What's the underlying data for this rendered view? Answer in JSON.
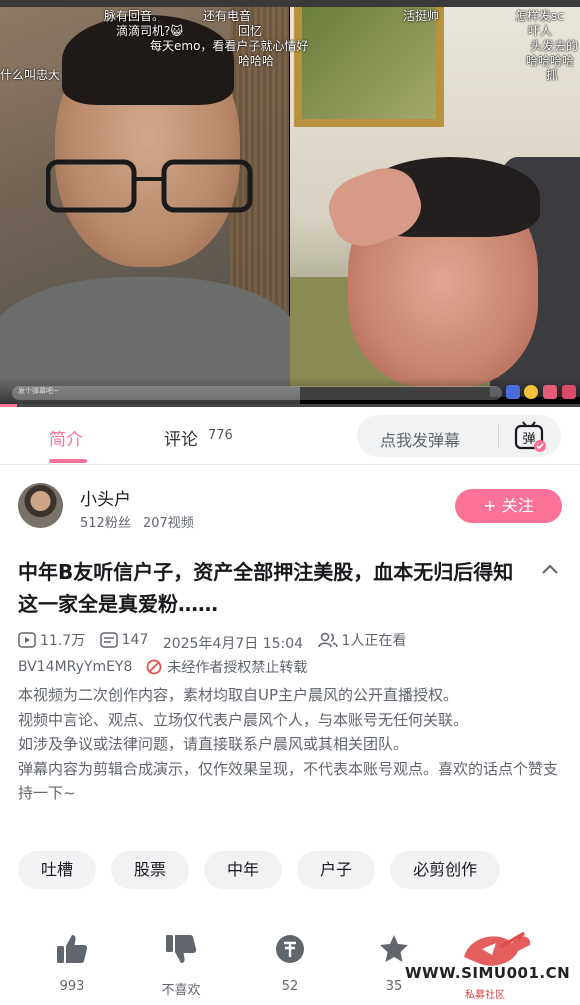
{
  "player": {
    "danmaku": [
      "脉有回音。",
      "还有电音",
      "滴滴司机?😺",
      "回忆",
      "每天emo，看看户子就心情好",
      "哈哈哈",
      "什么叫忠大",
      "活挺帅",
      "怎样发sc",
      "吓人",
      "头发去的",
      "哈哈哈哈",
      "抓"
    ],
    "input_hint": "发个弹幕吧~",
    "progress_fraction": 0.03
  },
  "tabs": {
    "intro_label": "简介",
    "comments_label": "评论",
    "comments_count": "776",
    "danmaku_placeholder": "点我发弹幕",
    "danmaku_toggle_glyph": "弹"
  },
  "uploader": {
    "name": "小头户",
    "followers": "512粉丝",
    "videos": "207视频",
    "follow_label": "+ 关注"
  },
  "video": {
    "title": "中年B友听信户子，资产全部押注美股，血本无归后得知这一家全是真爱粉……",
    "views": "11.7万",
    "danmaku_count": "147",
    "date": "2025年4月7日 15:04",
    "watching": "1人正在看",
    "bvid": "BV14MRyYmEY8",
    "repost_notice": "未经作者授权禁止转载",
    "description": [
      "本视频为二次创作内容，素材均取自UP主户晨风的公开直播授权。",
      "视频中言论、观点、立场仅代表户晨风个人，与本账号无任何关联。",
      "如涉及争议或法律问题，请直接联系户晨风或其相关团队。",
      "弹幕内容为剪辑合成演示，仅作效果呈现，不代表本账号观点。喜欢的话点个赞支持一下~"
    ]
  },
  "tags": [
    "吐槽",
    "股票",
    "中年",
    "户子",
    "必剪创作"
  ],
  "actions": {
    "like": "993",
    "dislike": "不喜欢",
    "coin": "52",
    "favorite": "35"
  },
  "watermark": {
    "text": "WWW.SIMU001.CN",
    "sub": "私募社区"
  },
  "colors": {
    "accent": "#fb7299",
    "text_primary": "#18191c",
    "text_secondary": "#61666d",
    "chip_bg": "#f1f2f3"
  }
}
